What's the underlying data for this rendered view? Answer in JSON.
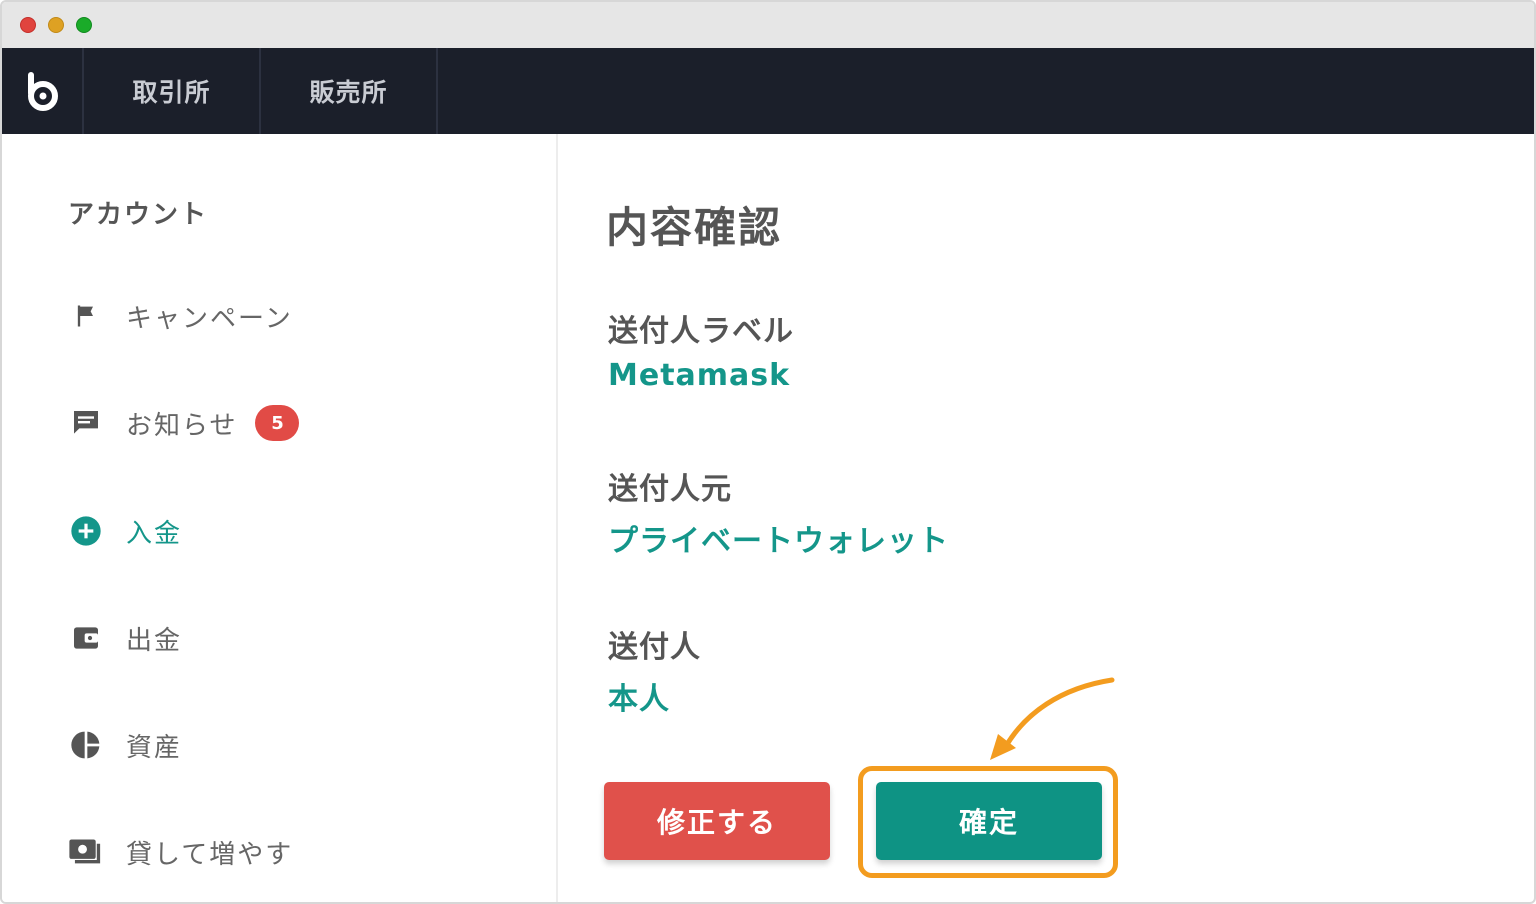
{
  "window": {
    "controls": [
      "close",
      "minimize",
      "maximize"
    ]
  },
  "navbar": {
    "logo_icon": "bitbank-logo-icon",
    "tabs": [
      {
        "label": "取引所"
      },
      {
        "label": "販売所"
      }
    ]
  },
  "sidebar": {
    "title": "アカウント",
    "items": [
      {
        "label": "キャンペーン",
        "icon": "flag-icon"
      },
      {
        "label": "お知らせ",
        "icon": "message-icon",
        "badge": "5"
      },
      {
        "label": "入金",
        "icon": "plus-circle-icon",
        "active": true
      },
      {
        "label": "出金",
        "icon": "wallet-icon"
      },
      {
        "label": "資産",
        "icon": "pie-chart-icon"
      },
      {
        "label": "貸して増やす",
        "icon": "lend-icon"
      }
    ]
  },
  "main": {
    "title": "内容確認",
    "fields": [
      {
        "label": "送付人ラベル",
        "value": "Metamask"
      },
      {
        "label": "送付人元",
        "value": "プライベートウォレット"
      },
      {
        "label": "送付人",
        "value": "本人"
      }
    ],
    "buttons": {
      "edit": "修正する",
      "confirm": "確定"
    }
  },
  "colors": {
    "accent": "#14968a",
    "danger": "#e0514b",
    "highlight": "#f39c1f",
    "navbar": "#1b1f2a"
  }
}
